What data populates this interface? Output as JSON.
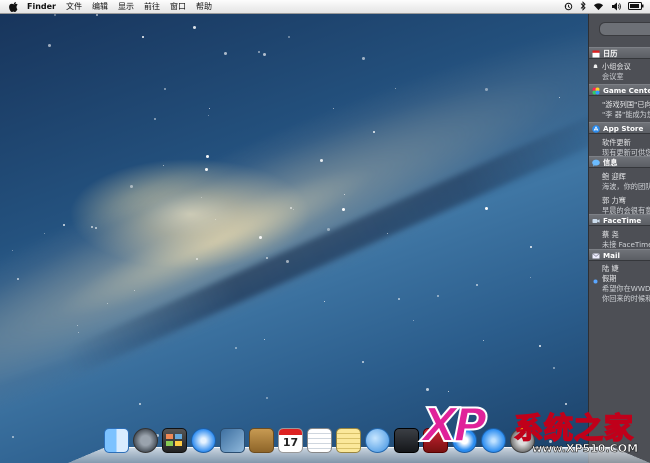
{
  "menubar": {
    "app_name": "Finder",
    "items": [
      "文件",
      "编辑",
      "显示",
      "前往",
      "窗口",
      "帮助"
    ]
  },
  "notification_center": {
    "sections": [
      {
        "app": "日历",
        "icon": "calendar-icon",
        "lines": [
          "小组会议",
          "会议室"
        ]
      },
      {
        "app": "Game Center",
        "icon": "game-center-icon",
        "lines": [
          "\"游戏列国\"已向您",
          "\"李 器\"能成为您"
        ]
      },
      {
        "app": "App Store",
        "icon": "app-store-icon",
        "lines": [
          "软件更新",
          "现有更新可供您"
        ]
      },
      {
        "app": "信息",
        "icon": "messages-icon",
        "lines": [
          "鲍 迎辉",
          "海波，你的团队",
          "郭 力骞",
          "早晨的会很有意"
        ]
      },
      {
        "app": "FaceTime",
        "icon": "facetime-icon",
        "lines": [
          "蔡 尧",
          "未接 FaceTime"
        ]
      },
      {
        "app": "Mail",
        "icon": "mail-icon",
        "lines": [
          "陆 婕",
          "假期",
          "希望你在WWDC",
          "你回来的时候和"
        ]
      }
    ]
  },
  "dock": {
    "items": [
      "finder-icon",
      "launchpad-icon",
      "mission-control-icon",
      "safari-icon",
      "preview-icon",
      "contacts-icon",
      "calendar-icon",
      "reminders-icon",
      "notes-icon",
      "messages-icon",
      "facetime-icon",
      "photo-booth-icon",
      "itunes-icon",
      "app-store-icon",
      "system-preferences-icon"
    ],
    "calendar_date": "17"
  },
  "watermark": {
    "logo": "XP",
    "brand": "系统之家",
    "url": "www.XP510.COM"
  },
  "colors": {
    "nc_background": "#4d4f55",
    "watermark_pink": "#e0229a",
    "watermark_yellow": "#ffe000"
  }
}
